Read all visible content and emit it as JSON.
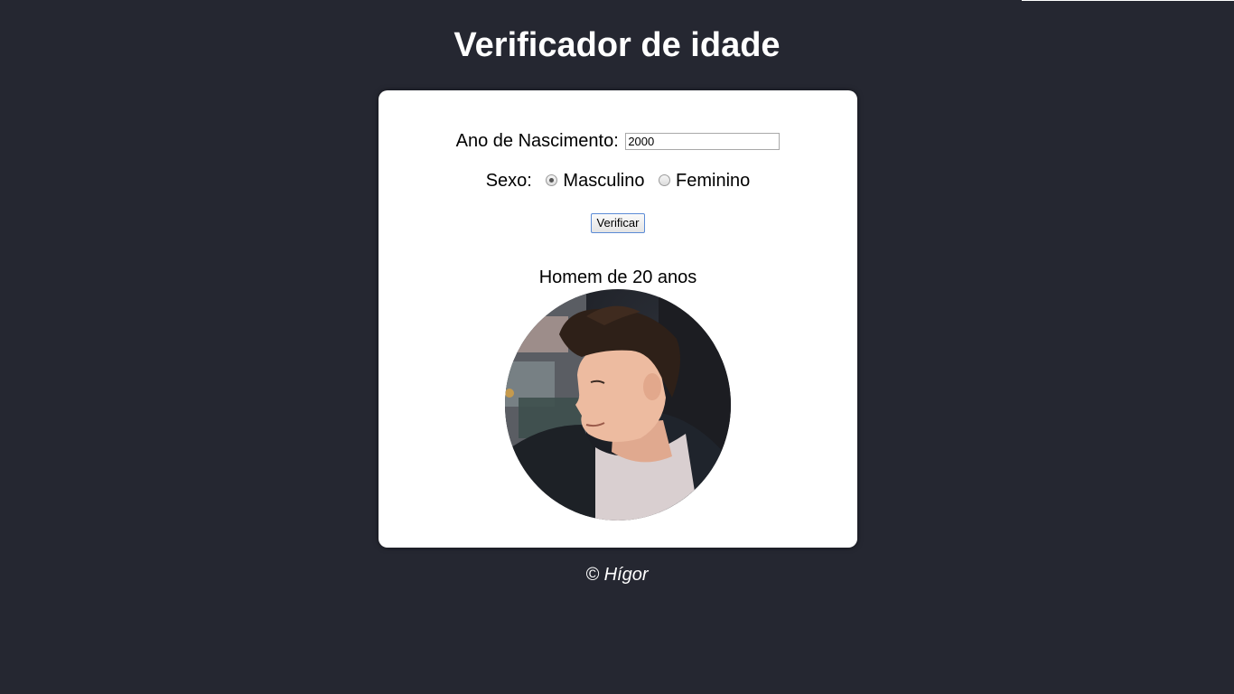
{
  "page": {
    "title": "Verificador de idade",
    "background_color": "#252731"
  },
  "form": {
    "year_label": "Ano de Nascimento:",
    "year_value": "2000",
    "sex_label": "Sexo:",
    "sex_options": [
      {
        "label": "Masculino",
        "selected": true
      },
      {
        "label": "Feminino",
        "selected": false
      }
    ],
    "verify_button": "Verificar"
  },
  "result": {
    "text": "Homem de 20 anos",
    "image_icon": "young-man-photo"
  },
  "footer": {
    "text": "© Hígor"
  }
}
